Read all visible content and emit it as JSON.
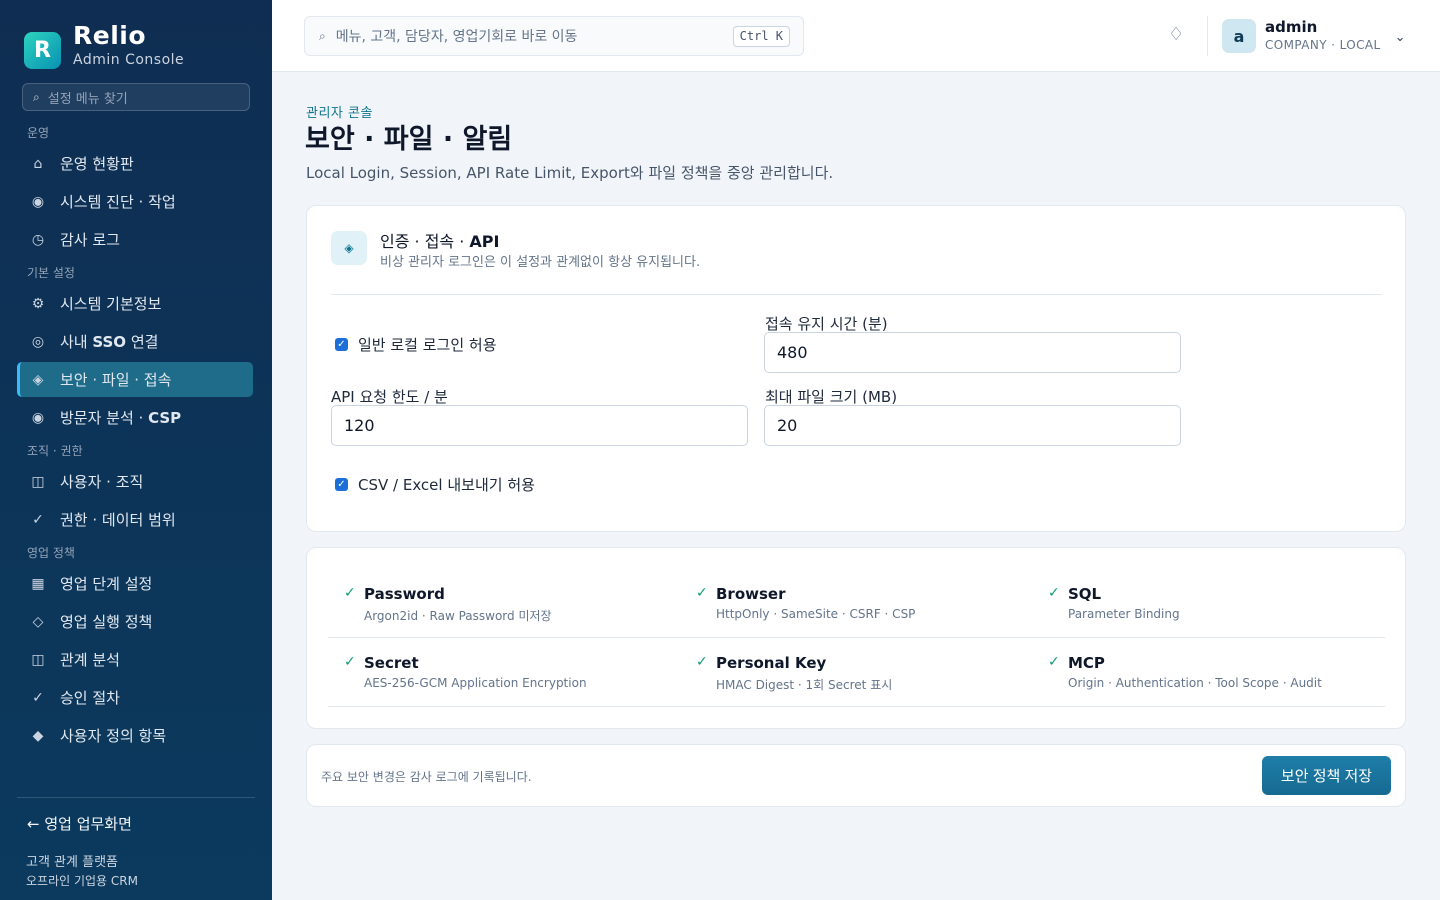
{
  "brand": {
    "logo_letter": "R",
    "name": "Relio",
    "subtitle": "Admin Console"
  },
  "sidebar": {
    "search_placeholder": "설정 메뉴 찾기",
    "groups": [
      {
        "label": "운영",
        "items": [
          {
            "icon": "home-icon",
            "glyph": "⌂",
            "label": "운영 현황판"
          },
          {
            "icon": "target-icon",
            "glyph": "◉",
            "label": "시스템 진단 · 작업"
          },
          {
            "icon": "clock-icon",
            "glyph": "◷",
            "label": "감사 로그"
          }
        ]
      },
      {
        "label": "기본 설정",
        "items": [
          {
            "icon": "gear-icon",
            "glyph": "⚙",
            "label": "시스템 기본정보"
          },
          {
            "icon": "ring-icon",
            "glyph": "◎",
            "label_prefix": "사내 ",
            "label_bold": "SSO",
            "label_suffix": " 연결"
          },
          {
            "icon": "diamond-icon",
            "glyph": "◈",
            "label": "보안 · 파일 · 접속",
            "active": true
          },
          {
            "icon": "target-icon",
            "glyph": "◉",
            "label_prefix": "방문자 분석 · ",
            "label_bold": "CSP",
            "label_suffix": ""
          }
        ]
      },
      {
        "label": "조직 · 권한",
        "items": [
          {
            "icon": "panel-icon",
            "glyph": "◫",
            "label": "사용자 · 조직"
          },
          {
            "icon": "check-icon",
            "glyph": "✓",
            "label": "권한 · 데이터 범위"
          }
        ]
      },
      {
        "label": "영업 정책",
        "items": [
          {
            "icon": "grid-icon",
            "glyph": "▦",
            "label": "영업 단계 설정"
          },
          {
            "icon": "diamond-outline-icon",
            "glyph": "◇",
            "label": "영업 실행 정책"
          },
          {
            "icon": "panel-icon",
            "glyph": "◫",
            "label": "관계 분석"
          },
          {
            "icon": "check-icon",
            "glyph": "✓",
            "label": "승인 절차"
          },
          {
            "icon": "diamond-filled-icon",
            "glyph": "◆",
            "label": "사용자 정의 항목"
          }
        ]
      }
    ],
    "back_link": "← 영업 업무화면",
    "footer_line1": "고객 관계 플랫폼",
    "footer_line2": "오프라인 기업용 CRM"
  },
  "topbar": {
    "search_placeholder": "메뉴, 고객, 담당자, 영업기회로 바로 이동",
    "shortcut": "Ctrl K",
    "user_initial": "a",
    "user_name": "admin",
    "user_role": "COMPANY · LOCAL"
  },
  "page": {
    "eyebrow": "관리자 콘솔",
    "title": "보안 · 파일 · 알림",
    "description": "Local Login, Session, API Rate Limit, Export와 파일 정책을 중앙 관리합니다."
  },
  "auth_card": {
    "title_prefix": "인증 · 접속 · ",
    "title_bold": "API",
    "subtitle": "비상 관리자 로그인은 이 설정과 관계없이 항상 유지됩니다.",
    "local_login_label": "일반 로컬 로그인 허용",
    "local_login_checked": true,
    "session_label": "접속 유지 시간 (분)",
    "session_value": "480",
    "rate_label": "API 요청 한도 / 분",
    "rate_value": "120",
    "file_size_label": "최대 파일 크기 (MB)",
    "file_size_value": "20",
    "export_label": "CSV / Excel 내보내기 허용",
    "export_checked": true
  },
  "features": [
    {
      "name": "Password",
      "desc": "Argon2id · Raw Password 미저장"
    },
    {
      "name": "Browser",
      "desc": "HttpOnly · SameSite · CSRF · CSP"
    },
    {
      "name": "SQL",
      "desc": "Parameter Binding"
    },
    {
      "name": "Secret",
      "desc": "AES-256-GCM Application Encryption"
    },
    {
      "name": "Personal Key",
      "desc": "HMAC Digest · 1회 Secret 표시"
    },
    {
      "name": "MCP",
      "desc": "Origin · Authentication · Tool Scope · Audit"
    }
  ],
  "footer_bar": {
    "note": "주요 보안 변경은 감사 로그에 기록됩니다.",
    "save_label": "보안 정책 저장"
  },
  "colors": {
    "sidebar_bg": "#0f2d52",
    "accent": "#1e7ea8",
    "active_item": "#1e6b8a",
    "check_green": "#0f9d76",
    "checkbox_blue": "#1d6fd8"
  }
}
